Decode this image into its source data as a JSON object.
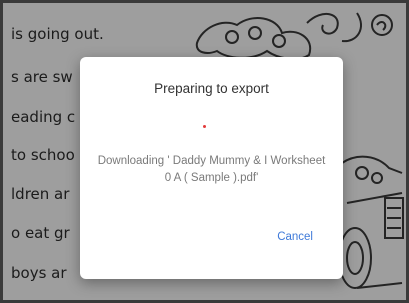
{
  "background_page": {
    "lines": [
      "is going out.",
      "s are sw",
      "eading c",
      "to schoo",
      "ldren ar",
      "o eat gr",
      "boys ar"
    ]
  },
  "dialog": {
    "title": "Preparing to export",
    "message": "Downloading ' Daddy Mummy & I Worksheet 0 A ( Sample ).pdf'",
    "cancel_label": "Cancel"
  },
  "colors": {
    "accent": "#3f7ad9",
    "spinner": "#e23a3a"
  }
}
